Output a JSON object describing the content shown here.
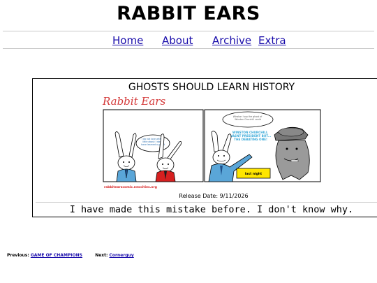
{
  "site": {
    "title": "RABBIT EARS"
  },
  "nav": [
    "Home",
    "About",
    "Archive",
    "Extra"
  ],
  "comic": {
    "title": "GHOSTS SHOULD LEARN HISTORY",
    "logo_text": "Rabbit Ears",
    "url_text": "rabbitearscomic.neocities.org",
    "panel1_bubble": "I do not love with it little about I don't have learned a the ghost of a ghost",
    "panel2_bubble": "Winston I say the ghost of Winston Churchill could dance around love of",
    "panel2_shout": "WINSTON CHURCHILL WASNT PRESIDENT BUT... THE DEBATING ONE!",
    "sign_text": "last night",
    "release_date": "Release Date: 9/11/2026",
    "caption": "I have made this mistake before. I don't know why."
  },
  "footer": {
    "prev_label": "Previous:",
    "prev_link": "GAME OF CHAMPIONS",
    "next_label": "Next:",
    "next_link": "Cornerguy"
  },
  "colors": {
    "link": "#1a0dab",
    "rabbit_suit_blue": "#5aa6d8",
    "rabbit_suit_red": "#d62020",
    "shout_text": "#39a9d8",
    "sign_yellow": "#ffe600",
    "logo_red": "#d43a3a"
  }
}
